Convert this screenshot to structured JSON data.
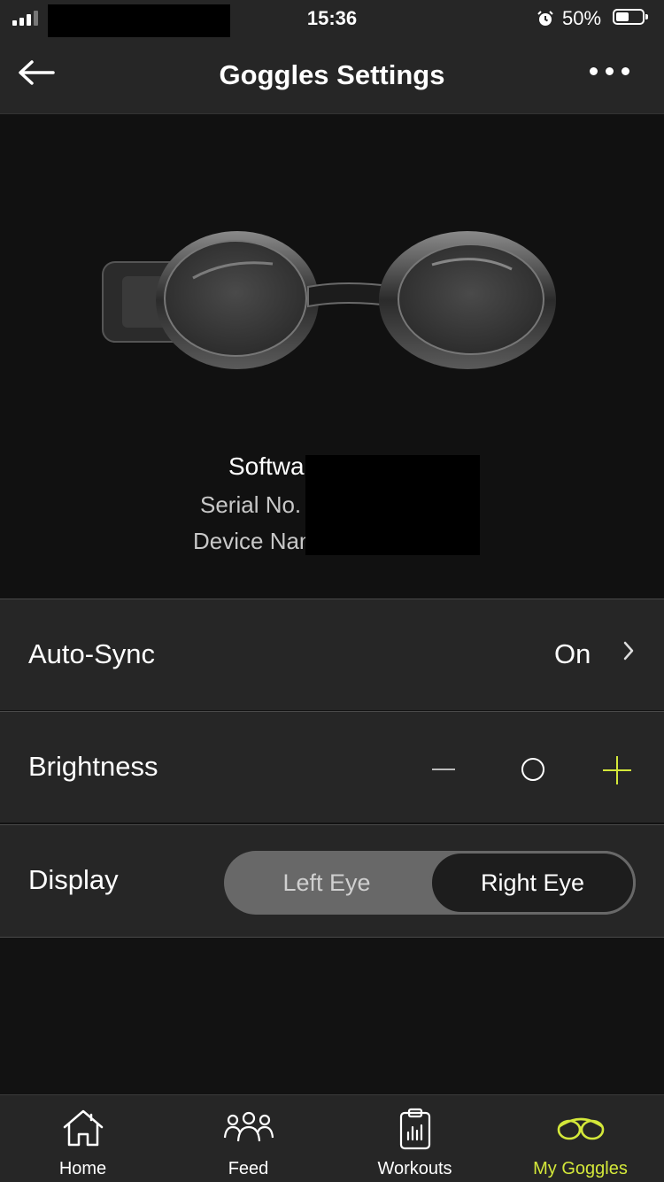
{
  "status_bar": {
    "time": "15:36",
    "battery": "50%"
  },
  "header": {
    "title": "Goggles Settings"
  },
  "device_info": {
    "software_label": "Software",
    "serial_label": "Serial No.",
    "device_name_label": "Device Name:"
  },
  "settings": {
    "auto_sync": {
      "label": "Auto-Sync",
      "value": "On"
    },
    "brightness": {
      "label": "Brightness"
    },
    "display": {
      "label": "Display",
      "options": [
        "Left Eye",
        "Right Eye"
      ],
      "selected": "Right Eye"
    }
  },
  "tabs": [
    {
      "label": "Home",
      "icon": "home-icon"
    },
    {
      "label": "Feed",
      "icon": "people-icon"
    },
    {
      "label": "Workouts",
      "icon": "clipboard-chart-icon"
    },
    {
      "label": "My Goggles",
      "icon": "goggles-icon",
      "active": true
    }
  ],
  "colors": {
    "accent": "#d4e83a",
    "background": "#121212",
    "surface": "#262626"
  }
}
